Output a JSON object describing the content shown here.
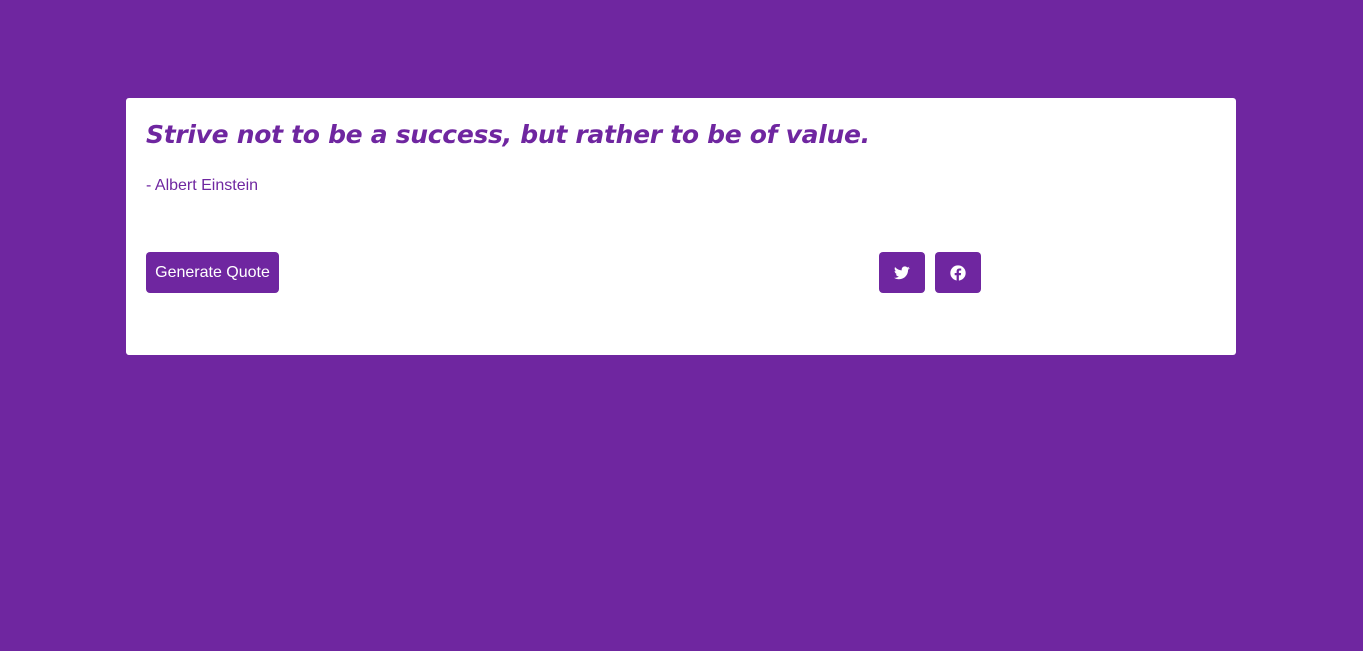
{
  "theme": {
    "background": "#6f26a0",
    "card": "#ffffff",
    "accent": "#6f26a0"
  },
  "quote": {
    "text": "Strive not to be a success, but rather to be of value.",
    "author": "- Albert Einstein"
  },
  "actions": {
    "generate_label": "Generate Quote",
    "twitter_icon": "twitter-icon",
    "facebook_icon": "facebook-icon"
  }
}
